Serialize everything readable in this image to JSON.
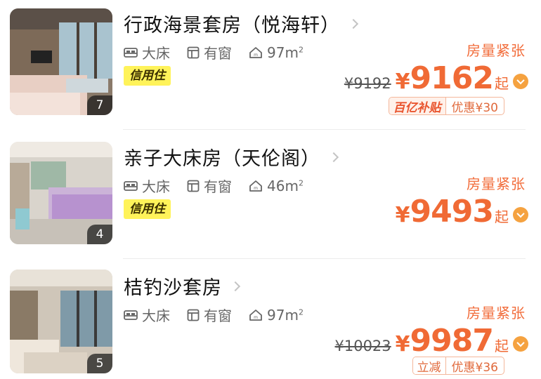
{
  "rooms": [
    {
      "title": "行政海景套房（悦海轩）",
      "photo_count": "7",
      "bed": "大床",
      "window": "有窗",
      "area": "97m",
      "area_unit_sup": "2",
      "badge": "信用住",
      "scarcity": "房量紧张",
      "original_price": "¥9192",
      "currency": "¥",
      "price": "9162",
      "price_suffix": "起",
      "promo_tag": "百亿补贴",
      "promo_discount": "优惠¥30"
    },
    {
      "title": "亲子大床房（天伦阁）",
      "photo_count": "4",
      "bed": "大床",
      "window": "有窗",
      "area": "46m",
      "area_unit_sup": "2",
      "badge": "信用住",
      "scarcity": "房量紧张",
      "currency": "¥",
      "price": "9493",
      "price_suffix": "起"
    },
    {
      "title": "桔钓沙套房",
      "photo_count": "5",
      "bed": "大床",
      "window": "有窗",
      "area": "97m",
      "area_unit_sup": "2",
      "scarcity": "房量紧张",
      "original_price": "¥10023",
      "currency": "¥",
      "price": "9987",
      "price_suffix": "起",
      "promo_tag": "立减",
      "promo_discount": "优惠¥36"
    }
  ],
  "icons": {
    "bed": "bed-icon",
    "window": "window-icon",
    "area": "house-area-icon",
    "chevron": "chevron-right-icon",
    "price_info": "chevron-down-circle-icon"
  },
  "colors": {
    "accent": "#f06a35",
    "credit_badge": "#fff35a",
    "info_dot": "#f5a240"
  }
}
